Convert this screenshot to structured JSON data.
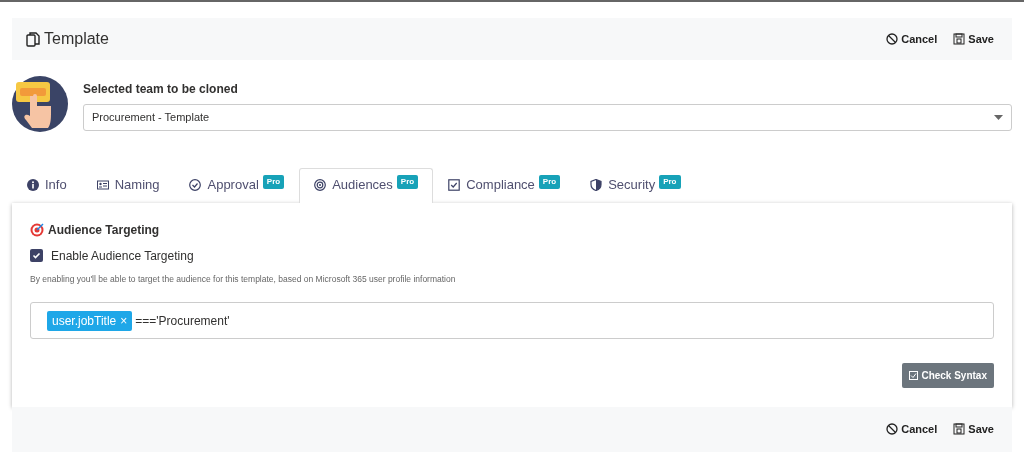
{
  "header": {
    "title": "Template",
    "actions": [
      {
        "label": "Cancel",
        "kind": "cancel"
      },
      {
        "label": "Save",
        "kind": "save"
      }
    ]
  },
  "team": {
    "label": "Selected team to be cloned",
    "value": "Procurement - Template"
  },
  "tabs": [
    {
      "label": "Info",
      "kind": "info",
      "selected": false
    },
    {
      "label": "Naming",
      "kind": "card",
      "selected": false
    },
    {
      "label": "Approval",
      "kind": "check-circle",
      "badge": "Pro",
      "selected": false
    },
    {
      "label": "Audiences",
      "kind": "target",
      "badge": "Pro",
      "selected": true
    },
    {
      "label": "Compliance",
      "kind": "check-square",
      "badge": "Pro",
      "selected": false
    },
    {
      "label": "Security",
      "kind": "shield",
      "badge": "Pro",
      "selected": false
    }
  ],
  "panel": {
    "title": "Audience Targeting",
    "checkbox": {
      "label": "Enable Audience Targeting",
      "checked": true
    },
    "help": "By enabling you'll be able to target the audience for this template, based on Microsoft 365 user profile information",
    "expression": {
      "token": "user.jobTitle",
      "remove": "×",
      "text": "==='Procurement'"
    },
    "button": "Check Syntax"
  },
  "footer": {
    "actions": [
      {
        "label": "Cancel",
        "kind": "cancel"
      },
      {
        "label": "Save",
        "kind": "save"
      }
    ]
  }
}
